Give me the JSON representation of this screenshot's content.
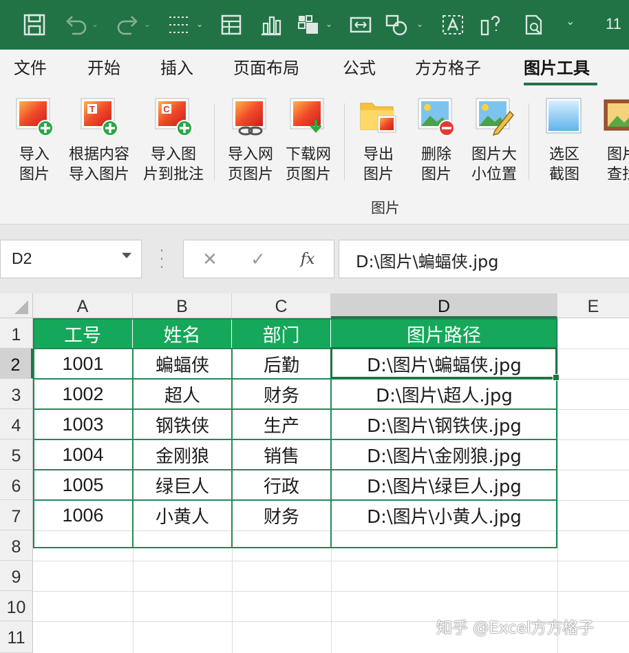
{
  "qat": {
    "overflow_text": "11"
  },
  "ribbon_tabs": [
    {
      "label": "文件"
    },
    {
      "label": "开始"
    },
    {
      "label": "插入"
    },
    {
      "label": "页面布局"
    },
    {
      "label": "公式"
    },
    {
      "label": "方方格子"
    },
    {
      "label": "图片工具",
      "active": true
    }
  ],
  "ribbon": {
    "group_label": "图片",
    "buttons": [
      {
        "label": "导入\n图片",
        "icon": "import-picture-icon"
      },
      {
        "label": "根据内容\n导入图片",
        "icon": "import-by-content-icon"
      },
      {
        "label": "导入图\n片到批注",
        "icon": "import-to-comment-icon"
      },
      {
        "label": "导入网\n页图片",
        "icon": "import-web-picture-icon"
      },
      {
        "label": "下载网\n页图片",
        "icon": "download-web-picture-icon"
      },
      {
        "label": "导出\n图片",
        "icon": "export-picture-icon"
      },
      {
        "label": "删除\n图片",
        "icon": "delete-picture-icon"
      },
      {
        "label": "图片大\n小位置",
        "icon": "picture-size-position-icon"
      },
      {
        "label": "选区\n截图",
        "icon": "selection-screenshot-icon"
      },
      {
        "label": "图片\n查找",
        "icon": "picture-find-icon"
      }
    ]
  },
  "formula_bar": {
    "name_box": "D2",
    "fx_label": "fx",
    "formula": "D:\\图片\\蝙蝠侠.jpg"
  },
  "sheet": {
    "columns": [
      "A",
      "B",
      "C",
      "D",
      "E"
    ],
    "selected_column": "D",
    "rows": [
      "1",
      "2",
      "3",
      "4",
      "5",
      "6",
      "7",
      "8",
      "9",
      "10",
      "11"
    ],
    "selected_row": "2",
    "active_cell": "D2",
    "table": {
      "header": [
        "工号",
        "姓名",
        "部门",
        "图片路径"
      ],
      "data": [
        [
          "1001",
          "蝙蝠侠",
          "后勤",
          "D:\\图片\\蝙蝠侠.jpg"
        ],
        [
          "1002",
          "超人",
          "财务",
          "D:\\图片\\超人.jpg"
        ],
        [
          "1003",
          "钢铁侠",
          "生产",
          "D:\\图片\\钢铁侠.jpg"
        ],
        [
          "1004",
          "金刚狼",
          "销售",
          "D:\\图片\\金刚狼.jpg"
        ],
        [
          "1005",
          "绿巨人",
          "行政",
          "D:\\图片\\绿巨人.jpg"
        ],
        [
          "1006",
          "小黄人",
          "财务",
          "D:\\图片\\小黄人.jpg"
        ]
      ]
    }
  },
  "colors": {
    "excel_green": "#217346",
    "table_header_fill": "#16a85a",
    "table_border": "#1f8a58"
  },
  "watermark": "知乎 @Excel方方格子"
}
